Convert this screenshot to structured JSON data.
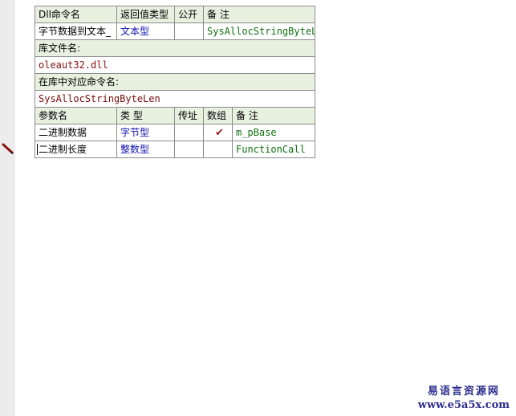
{
  "dll_header": {
    "col_name": "Dll命令名",
    "col_return_type": "返回值类型",
    "col_public": "公开",
    "col_remark": "备 注"
  },
  "dll_row": {
    "name": "字节数据到文本_",
    "return_type": "文本型",
    "public": "",
    "remark": "SysAllocStringByteLen"
  },
  "library": {
    "label": "库文件名:",
    "value": "oleaut32.dll"
  },
  "command_in_library": {
    "label": "在库中对应命令名:",
    "value": "SysAllocStringByteLen"
  },
  "param_header": {
    "col_name": "参数名",
    "col_type": "类 型",
    "col_byref": "传址",
    "col_array": "数组",
    "col_remark": "备 注"
  },
  "params": [
    {
      "name": "二进制数据",
      "type": "字节型",
      "byref": "",
      "array": "✔",
      "remark": "m_pBase"
    },
    {
      "name": "二进制长度",
      "type": "整数型",
      "byref": "",
      "array": "",
      "remark": "FunctionCall"
    }
  ],
  "watermark": {
    "title": "易语言资源网",
    "url": "www.e5a5x.com"
  },
  "icons": {
    "edit_cursor": "pencil-icon",
    "array_check": "checkmark-icon"
  },
  "colors": {
    "header_bg": "#e8f0e0",
    "type_text": "#1010b0",
    "remark_text": "#107010",
    "library_text": "#8b1010",
    "checkmark": "#9b1c1c"
  }
}
